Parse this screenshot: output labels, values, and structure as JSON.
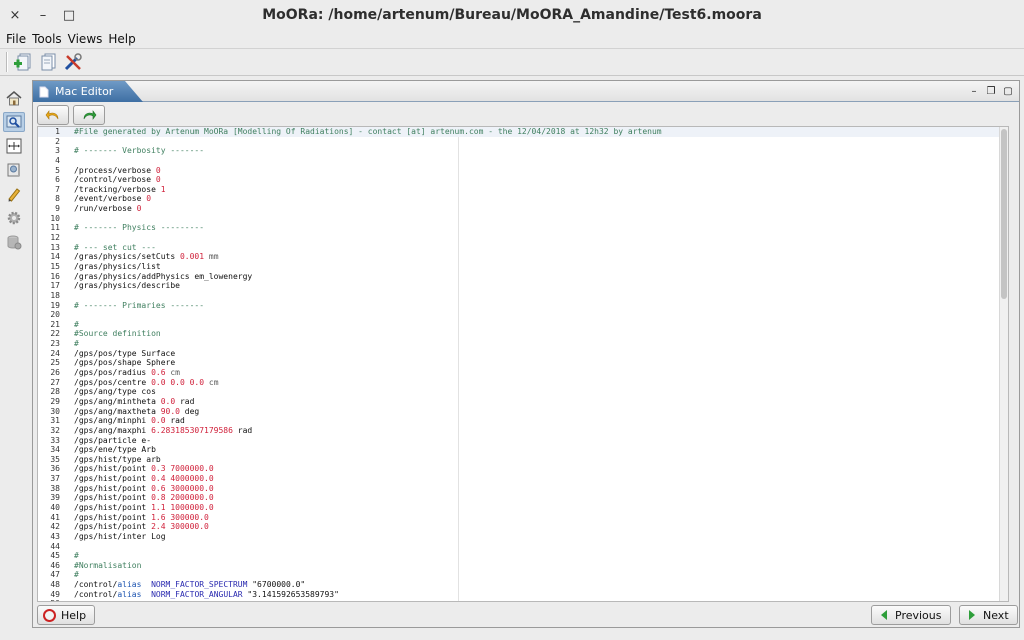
{
  "window": {
    "title": "MoORa: /home/artenum/Bureau/MoORA_Amandine/Test6.moora",
    "close_glyph": "×",
    "minimize_glyph": "–",
    "maximize_glyph": "□"
  },
  "menu": [
    "File",
    "Tools",
    "Views",
    "Help"
  ],
  "toolbar": {
    "icons": [
      "new-mac-file-icon",
      "documents-icon",
      "tools-icon"
    ]
  },
  "sidebar": {
    "items": [
      {
        "icon": "home-icon",
        "active": false
      },
      {
        "icon": "search-map-icon",
        "active": true
      },
      {
        "icon": "geometry-icon",
        "active": false
      },
      {
        "icon": "book-icon",
        "active": false
      },
      {
        "icon": "pencil-icon",
        "active": false
      },
      {
        "icon": "gear-icon",
        "active": false
      },
      {
        "icon": "database-icon",
        "active": false
      }
    ]
  },
  "panel": {
    "tab_label": "Mac Editor",
    "controls": [
      "–",
      "❐",
      "▢"
    ]
  },
  "editor": {
    "undo_icon": "undo-icon",
    "redo_icon": "redo-icon",
    "current_line": 1,
    "lines": [
      [
        [
          "c",
          "#File generated by Artenum MoORa [Modelling Of Radiations] - contact [at] artenum.com - the 12/04/2018 at 12h32 by artenum"
        ]
      ],
      [],
      [
        [
          "c",
          "# ------- Verbosity -------"
        ]
      ],
      [],
      [
        [
          "t",
          "/process/verbose "
        ],
        [
          "n",
          "0"
        ]
      ],
      [
        [
          "t",
          "/control/verbose "
        ],
        [
          "n",
          "0"
        ]
      ],
      [
        [
          "t",
          "/tracking/verbose "
        ],
        [
          "n",
          "1"
        ]
      ],
      [
        [
          "t",
          "/event/verbose "
        ],
        [
          "n",
          "0"
        ]
      ],
      [
        [
          "t",
          "/run/verbose "
        ],
        [
          "n",
          "0"
        ]
      ],
      [],
      [
        [
          "c",
          "# ------- Physics ---------"
        ]
      ],
      [],
      [
        [
          "c",
          "# --- set cut ---"
        ]
      ],
      [
        [
          "t",
          "/gras/physics/setCuts "
        ],
        [
          "n",
          "0.001"
        ],
        [
          "t",
          " "
        ],
        [
          "u",
          "mm"
        ]
      ],
      [
        [
          "t",
          "/gras/physics/list"
        ]
      ],
      [
        [
          "t",
          "/gras/physics/addPhysics em_lowenergy"
        ]
      ],
      [
        [
          "t",
          "/gras/physics/describe"
        ]
      ],
      [],
      [
        [
          "c",
          "# ------- Primaries -------"
        ]
      ],
      [],
      [
        [
          "c",
          "#"
        ]
      ],
      [
        [
          "c",
          "#Source definition"
        ]
      ],
      [
        [
          "c",
          "#"
        ]
      ],
      [
        [
          "t",
          "/gps/pos/type Surface"
        ]
      ],
      [
        [
          "t",
          "/gps/pos/shape Sphere"
        ]
      ],
      [
        [
          "t",
          "/gps/pos/radius "
        ],
        [
          "n",
          "0.6"
        ],
        [
          "t",
          " "
        ],
        [
          "u",
          "cm"
        ]
      ],
      [
        [
          "t",
          "/gps/pos/centre "
        ],
        [
          "n",
          "0.0 0.0 0.0"
        ],
        [
          "t",
          " "
        ],
        [
          "u",
          "cm"
        ]
      ],
      [
        [
          "t",
          "/gps/ang/type cos"
        ]
      ],
      [
        [
          "t",
          "/gps/ang/mintheta "
        ],
        [
          "n",
          "0.0"
        ],
        [
          "t",
          " rad"
        ]
      ],
      [
        [
          "t",
          "/gps/ang/maxtheta "
        ],
        [
          "n",
          "90.0"
        ],
        [
          "t",
          " deg"
        ]
      ],
      [
        [
          "t",
          "/gps/ang/minphi "
        ],
        [
          "n",
          "0.0"
        ],
        [
          "t",
          " rad"
        ]
      ],
      [
        [
          "t",
          "/gps/ang/maxphi "
        ],
        [
          "n",
          "6.283185307179586"
        ],
        [
          "t",
          " rad"
        ]
      ],
      [
        [
          "t",
          "/gps/particle e-"
        ]
      ],
      [
        [
          "t",
          "/gps/ene/type Arb"
        ]
      ],
      [
        [
          "t",
          "/gps/hist/type arb"
        ]
      ],
      [
        [
          "t",
          "/gps/hist/point "
        ],
        [
          "n",
          "0.3 7000000.0"
        ]
      ],
      [
        [
          "t",
          "/gps/hist/point "
        ],
        [
          "n",
          "0.4 4000000.0"
        ]
      ],
      [
        [
          "t",
          "/gps/hist/point "
        ],
        [
          "n",
          "0.6 3000000.0"
        ]
      ],
      [
        [
          "t",
          "/gps/hist/point "
        ],
        [
          "n",
          "0.8 2000000.0"
        ]
      ],
      [
        [
          "t",
          "/gps/hist/point "
        ],
        [
          "n",
          "1.1 1000000.0"
        ]
      ],
      [
        [
          "t",
          "/gps/hist/point "
        ],
        [
          "n",
          "1.6 300000.0"
        ]
      ],
      [
        [
          "t",
          "/gps/hist/point "
        ],
        [
          "n",
          "2.4 300000.0"
        ]
      ],
      [
        [
          "t",
          "/gps/hist/inter Log"
        ]
      ],
      [],
      [
        [
          "c",
          "#"
        ]
      ],
      [
        [
          "c",
          "#Normalisation"
        ]
      ],
      [
        [
          "c",
          "#"
        ]
      ],
      [
        [
          "t",
          "/control/"
        ],
        [
          "k",
          "alias"
        ],
        [
          "t",
          "  "
        ],
        [
          "s",
          "NORM_FACTOR_SPECTRUM"
        ],
        [
          "t",
          " \"6700000.0\""
        ]
      ],
      [
        [
          "t",
          "/control/"
        ],
        [
          "k",
          "alias"
        ],
        [
          "t",
          "  "
        ],
        [
          "s",
          "NORM_FACTOR_ANGULAR"
        ],
        [
          "t",
          " \"3.141592653589793\""
        ]
      ],
      []
    ]
  },
  "buttons": {
    "help": "Help",
    "previous": "Previous",
    "next": "Next"
  },
  "colors": {
    "comment": "#3f7f5f",
    "number": "#d0203a",
    "keyword": "#1b53b0",
    "tab_blue": "#4a7aad"
  }
}
